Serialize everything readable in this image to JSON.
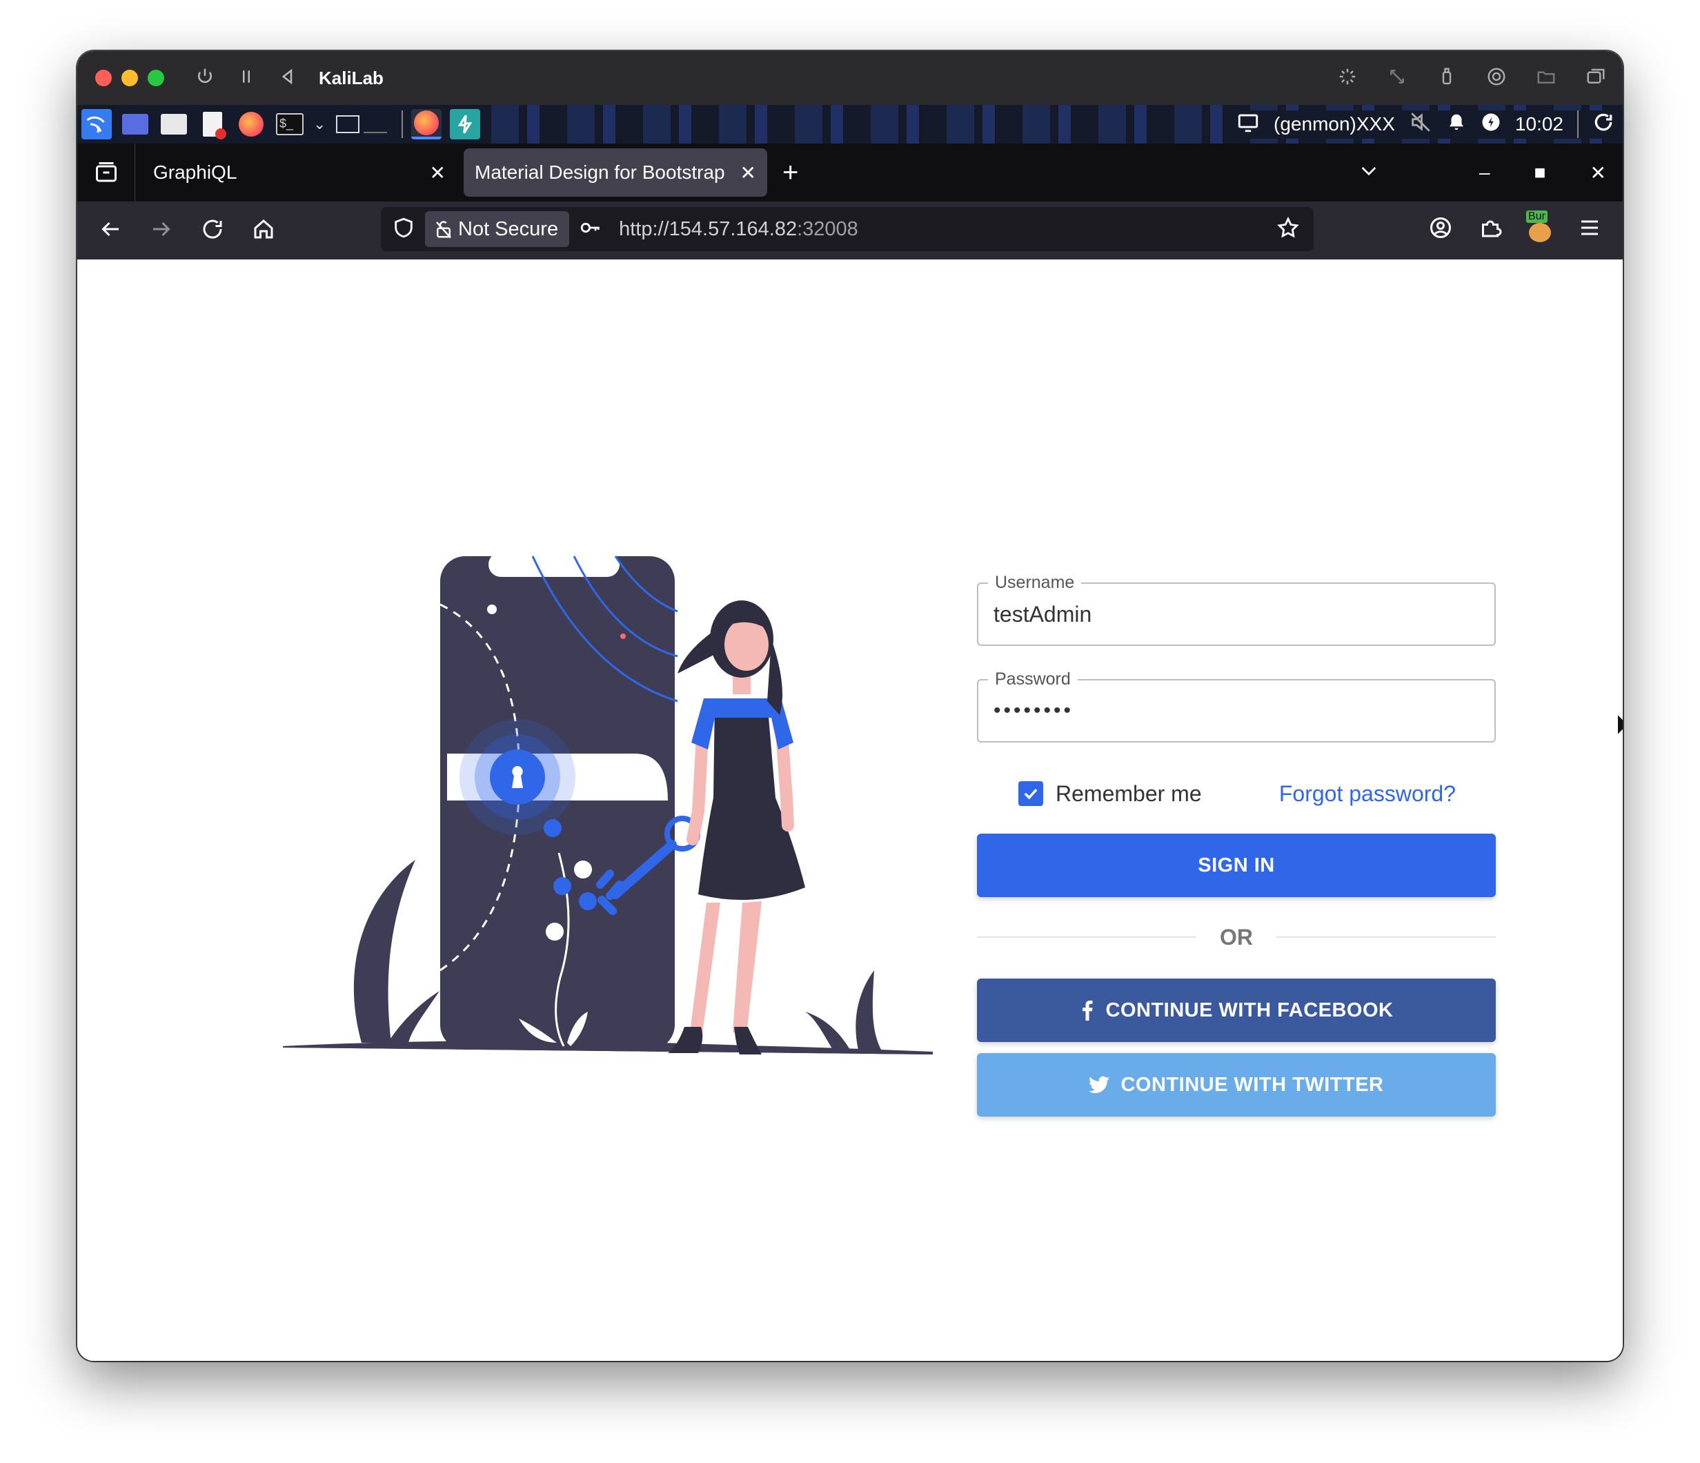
{
  "vm": {
    "title": "KaliLab",
    "traffic_colors": [
      "#ff5f57",
      "#febc2e",
      "#28c840"
    ]
  },
  "panel": {
    "genmon": "(genmon)XXX",
    "clock": "10:02"
  },
  "tabs": [
    {
      "title": "GraphiQL",
      "active": false
    },
    {
      "title": "Material Design for Bootstrap",
      "active": true
    }
  ],
  "urlbar": {
    "security_label": "Not Secure",
    "url_host": "http://154.57.164.82",
    "url_port": ":32008",
    "extension_badge": "Bur"
  },
  "login": {
    "username_label": "Username",
    "username_value": "testAdmin",
    "password_label": "Password",
    "password_value": "••••••••",
    "remember_label": "Remember me",
    "remember_checked": true,
    "forgot_label": "Forgot password?",
    "signin_label": "SIGN IN",
    "or_label": "OR",
    "facebook_label": "CONTINUE WITH FACEBOOK",
    "twitter_label": "CONTINUE WITH TWITTER"
  },
  "colors": {
    "primary": "#3066e8",
    "facebook": "#3b5a9d",
    "twitter": "#6aabe9",
    "illustration_dark": "#3f3d56",
    "illustration_accent": "#3066e8",
    "skin": "#f4b8b5"
  }
}
